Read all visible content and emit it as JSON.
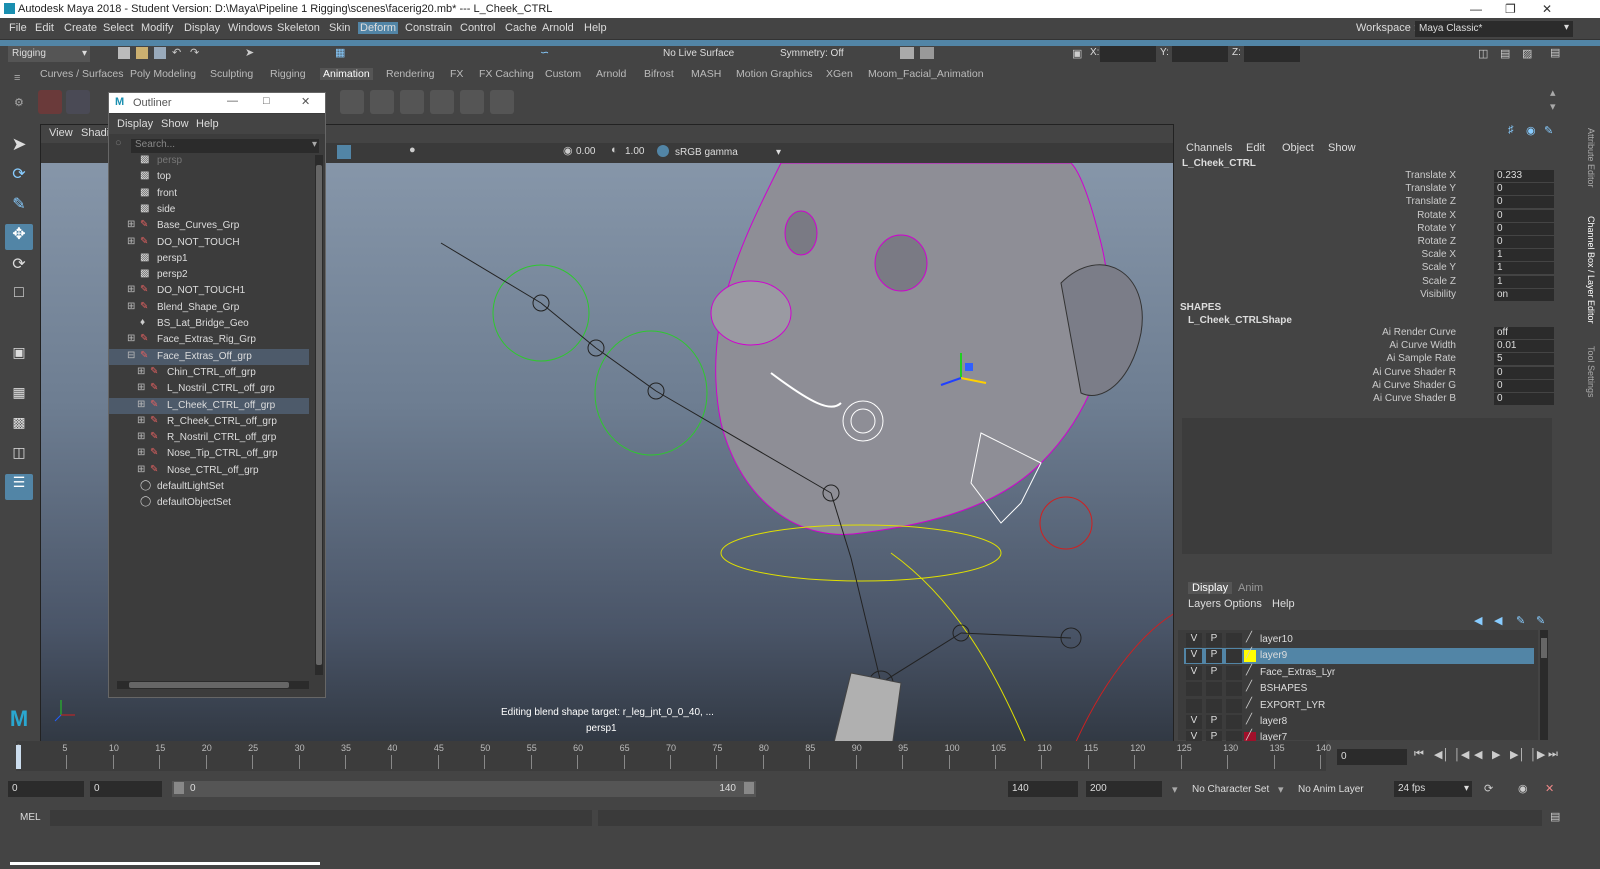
{
  "window": {
    "title": "Autodesk Maya 2018 - Student Version: D:\\Maya\\Pipeline 1 Rigging\\scenes\\facerig20.mb*  ---  L_Cheek_CTRL"
  },
  "menubar": {
    "items": [
      "File",
      "Edit",
      "Create",
      "Select",
      "Modify",
      "Display",
      "Windows",
      "Skeleton",
      "Skin",
      "Deform",
      "Constrain",
      "Control",
      "Cache",
      "Arnold",
      "Help"
    ],
    "active": "Deform",
    "workspace_label": "Workspace :",
    "workspace_value": "Maya Classic*"
  },
  "statusline": {
    "mode": "Rigging",
    "live_surface": "No Live Surface",
    "symmetry": "Symmetry: Off",
    "x_label": "X:",
    "y_label": "Y:",
    "z_label": "Z:"
  },
  "shelf": {
    "tabs": [
      "Curves / Surfaces",
      "Poly Modeling",
      "Sculpting",
      "Rigging",
      "Animation",
      "Rendering",
      "FX",
      "FX Caching",
      "Custom",
      "Arnold",
      "Bifrost",
      "MASH",
      "Motion Graphics",
      "XGen",
      "Moom_Facial_Animation"
    ],
    "active": "Animation"
  },
  "viewport": {
    "menus": [
      "View",
      "Shading"
    ],
    "near_value": "0.00",
    "far_value": "1.00",
    "color_space": "sRGB gamma",
    "hud_message": "Editing blend shape target: r_leg_jnt_0_0_40, ...",
    "camera": "persp1"
  },
  "outliner": {
    "title": "Outliner",
    "menus": [
      "Display",
      "Show",
      "Help"
    ],
    "search_placeholder": "Search...",
    "rows": [
      {
        "label": "persp",
        "indent": 0,
        "expand": false,
        "type": "camera",
        "dim": true
      },
      {
        "label": "top",
        "indent": 0,
        "expand": false,
        "type": "camera"
      },
      {
        "label": "front",
        "indent": 0,
        "expand": false,
        "type": "camera"
      },
      {
        "label": "side",
        "indent": 0,
        "expand": false,
        "type": "camera"
      },
      {
        "label": "Base_Curves_Grp",
        "indent": 0,
        "expand": true,
        "type": "group"
      },
      {
        "label": "DO_NOT_TOUCH",
        "indent": 0,
        "expand": true,
        "type": "group"
      },
      {
        "label": "persp1",
        "indent": 0,
        "expand": false,
        "type": "camera"
      },
      {
        "label": "persp2",
        "indent": 0,
        "expand": false,
        "type": "camera"
      },
      {
        "label": "DO_NOT_TOUCH1",
        "indent": 0,
        "expand": true,
        "type": "group"
      },
      {
        "label": "Blend_Shape_Grp",
        "indent": 0,
        "expand": true,
        "type": "group"
      },
      {
        "label": "BS_Lat_Bridge_Geo",
        "indent": 0,
        "expand": false,
        "type": "lattice"
      },
      {
        "label": "Face_Extras_Rig_Grp",
        "indent": 0,
        "expand": true,
        "type": "group"
      },
      {
        "label": "Face_Extras_Off_grp",
        "indent": 0,
        "expand": true,
        "type": "group",
        "open": true,
        "highlight": true
      },
      {
        "label": "Chin_CTRL_off_grp",
        "indent": 1,
        "expand": true,
        "type": "group"
      },
      {
        "label": "L_Nostril_CTRL_off_grp",
        "indent": 1,
        "expand": true,
        "type": "group"
      },
      {
        "label": "L_Cheek_CTRL_off_grp",
        "indent": 1,
        "expand": true,
        "type": "group",
        "selected": true
      },
      {
        "label": "R_Cheek_CTRL_off_grp",
        "indent": 1,
        "expand": true,
        "type": "group"
      },
      {
        "label": "R_Nostril_CTRL_off_grp",
        "indent": 1,
        "expand": true,
        "type": "group"
      },
      {
        "label": "Nose_Tip_CTRL_off_grp",
        "indent": 1,
        "expand": true,
        "type": "group"
      },
      {
        "label": "Nose_CTRL_off_grp",
        "indent": 1,
        "expand": true,
        "type": "group"
      },
      {
        "label": "defaultLightSet",
        "indent": 0,
        "expand": false,
        "type": "set"
      },
      {
        "label": "defaultObjectSet",
        "indent": 0,
        "expand": false,
        "type": "set"
      }
    ]
  },
  "channelbox": {
    "menus": [
      "Channels",
      "Edit",
      "Object",
      "Show"
    ],
    "object": "L_Cheek_CTRL",
    "channels": [
      {
        "name": "Translate X",
        "value": "0.233"
      },
      {
        "name": "Translate Y",
        "value": "0"
      },
      {
        "name": "Translate Z",
        "value": "0"
      },
      {
        "name": "Rotate X",
        "value": "0"
      },
      {
        "name": "Rotate Y",
        "value": "0"
      },
      {
        "name": "Rotate Z",
        "value": "0"
      },
      {
        "name": "Scale X",
        "value": "1"
      },
      {
        "name": "Scale Y",
        "value": "1"
      },
      {
        "name": "Scale Z",
        "value": "1"
      },
      {
        "name": "Visibility",
        "value": "on"
      }
    ],
    "shapes_header": "SHAPES",
    "shape_name": "L_Cheek_CTRLShape",
    "shape_channels": [
      {
        "name": "Ai Render Curve",
        "value": "off"
      },
      {
        "name": "Ai Curve Width",
        "value": "0.01"
      },
      {
        "name": "Ai Sample Rate",
        "value": "5"
      },
      {
        "name": "Ai Curve Shader R",
        "value": "0"
      },
      {
        "name": "Ai Curve Shader G",
        "value": "0"
      },
      {
        "name": "Ai Curve Shader B",
        "value": "0"
      }
    ]
  },
  "side_tabs": [
    "Attribute Editor",
    "Channel Box / Layer Editor",
    "Tool Settings"
  ],
  "layer_editor": {
    "tabs": [
      "Display",
      "Anim"
    ],
    "menus": [
      "Layers",
      "Options",
      "Help"
    ],
    "layers": [
      {
        "v": "V",
        "p": "P",
        "name": "layer10",
        "color": ""
      },
      {
        "v": "V",
        "p": "P",
        "name": "layer9",
        "color": "#ffff00",
        "selected": true
      },
      {
        "v": "V",
        "p": "P",
        "name": "Face_Extras_Lyr",
        "color": ""
      },
      {
        "v": "",
        "p": "",
        "name": "BSHAPES",
        "color": ""
      },
      {
        "v": "",
        "p": "",
        "name": "EXPORT_LYR",
        "color": ""
      },
      {
        "v": "V",
        "p": "P",
        "name": "layer8",
        "color": ""
      },
      {
        "v": "V",
        "p": "P",
        "name": "layer7",
        "color": "#a0102a"
      }
    ]
  },
  "timeline": {
    "ticks": [
      "0",
      "5",
      "10",
      "15",
      "20",
      "25",
      "30",
      "35",
      "40",
      "45",
      "50",
      "55",
      "60",
      "65",
      "70",
      "75",
      "80",
      "85",
      "90",
      "95",
      "100",
      "105",
      "110",
      "115",
      "120",
      "125",
      "130",
      "135",
      "140"
    ],
    "current_frame": "0"
  },
  "range": {
    "start": "0",
    "playback_start": "0",
    "slider_start": "0",
    "slider_end": "140",
    "playback_end": "140",
    "end": "200",
    "character_set": "No Character Set",
    "anim_layer": "No Anim Layer",
    "fps": "24 fps"
  },
  "cmdline": {
    "label": "MEL"
  },
  "colors": {
    "accent": "#5285a6",
    "panel": "#444444",
    "field": "#2b2b2b"
  }
}
